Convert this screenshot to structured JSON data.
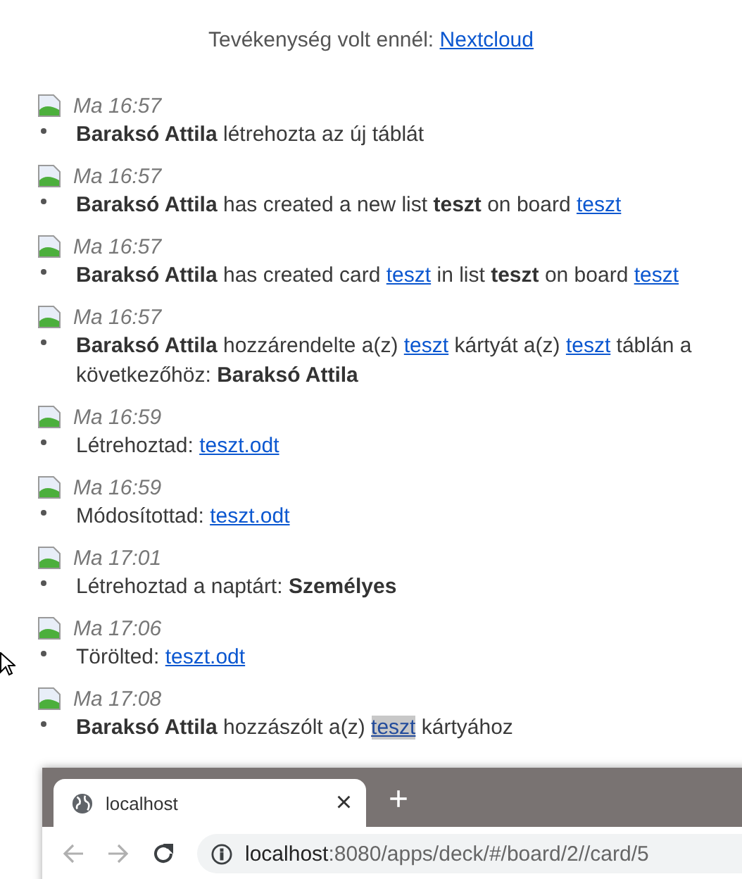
{
  "header": {
    "text": "Tevékenység volt ennél:",
    "link": "Nextcloud"
  },
  "activities": [
    {
      "time": "Ma 16:57",
      "segments": [
        {
          "kind": "bold",
          "text": "Baraksó Attila"
        },
        {
          "kind": "plain",
          "text": " létrehozta az új táblát"
        }
      ]
    },
    {
      "time": "Ma 16:57",
      "segments": [
        {
          "kind": "bold",
          "text": "Baraksó Attila"
        },
        {
          "kind": "plain",
          "text": " has created a new list "
        },
        {
          "kind": "bold",
          "text": "teszt"
        },
        {
          "kind": "plain",
          "text": " on board "
        },
        {
          "kind": "link",
          "text": "teszt"
        }
      ]
    },
    {
      "time": "Ma 16:57",
      "segments": [
        {
          "kind": "bold",
          "text": "Baraksó Attila"
        },
        {
          "kind": "plain",
          "text": " has created card "
        },
        {
          "kind": "link",
          "text": "teszt"
        },
        {
          "kind": "plain",
          "text": " in list "
        },
        {
          "kind": "bold",
          "text": "teszt"
        },
        {
          "kind": "plain",
          "text": " on board "
        },
        {
          "kind": "link",
          "text": "teszt"
        }
      ]
    },
    {
      "time": "Ma 16:57",
      "segments": [
        {
          "kind": "bold",
          "text": "Baraksó Attila"
        },
        {
          "kind": "plain",
          "text": " hozzárendelte a(z) "
        },
        {
          "kind": "link",
          "text": "teszt"
        },
        {
          "kind": "plain",
          "text": " kártyát a(z) "
        },
        {
          "kind": "link",
          "text": "teszt"
        },
        {
          "kind": "plain",
          "text": " táblán a következőhöz: "
        },
        {
          "kind": "bold",
          "text": "Baraksó Attila"
        }
      ]
    },
    {
      "time": "Ma 16:59",
      "segments": [
        {
          "kind": "plain",
          "text": "Létrehoztad: "
        },
        {
          "kind": "link",
          "text": "teszt.odt"
        }
      ]
    },
    {
      "time": "Ma 16:59",
      "segments": [
        {
          "kind": "plain",
          "text": "Módosítottad: "
        },
        {
          "kind": "link",
          "text": "teszt.odt"
        }
      ]
    },
    {
      "time": "Ma 17:01",
      "segments": [
        {
          "kind": "plain",
          "text": "Létrehoztad a naptárt: "
        },
        {
          "kind": "bold",
          "text": "Személyes"
        }
      ]
    },
    {
      "time": "Ma 17:06",
      "segments": [
        {
          "kind": "plain",
          "text": "Törölted: "
        },
        {
          "kind": "link",
          "text": "teszt.odt"
        }
      ]
    },
    {
      "time": "Ma 17:08",
      "segments": [
        {
          "kind": "bold",
          "text": "Baraksó Attila"
        },
        {
          "kind": "plain",
          "text": " hozzászólt a(z) "
        },
        {
          "kind": "marked-link",
          "text": "teszt"
        },
        {
          "kind": "plain",
          "text": " kártyához"
        }
      ]
    }
  ],
  "browser": {
    "tab_title": "localhost",
    "close": "×",
    "new_tab": "+",
    "back": {
      "disabled": true
    },
    "forward": {
      "disabled": true
    },
    "url_host": "localhost",
    "url_path": ":8080/apps/deck/#/board/2//card/5"
  }
}
